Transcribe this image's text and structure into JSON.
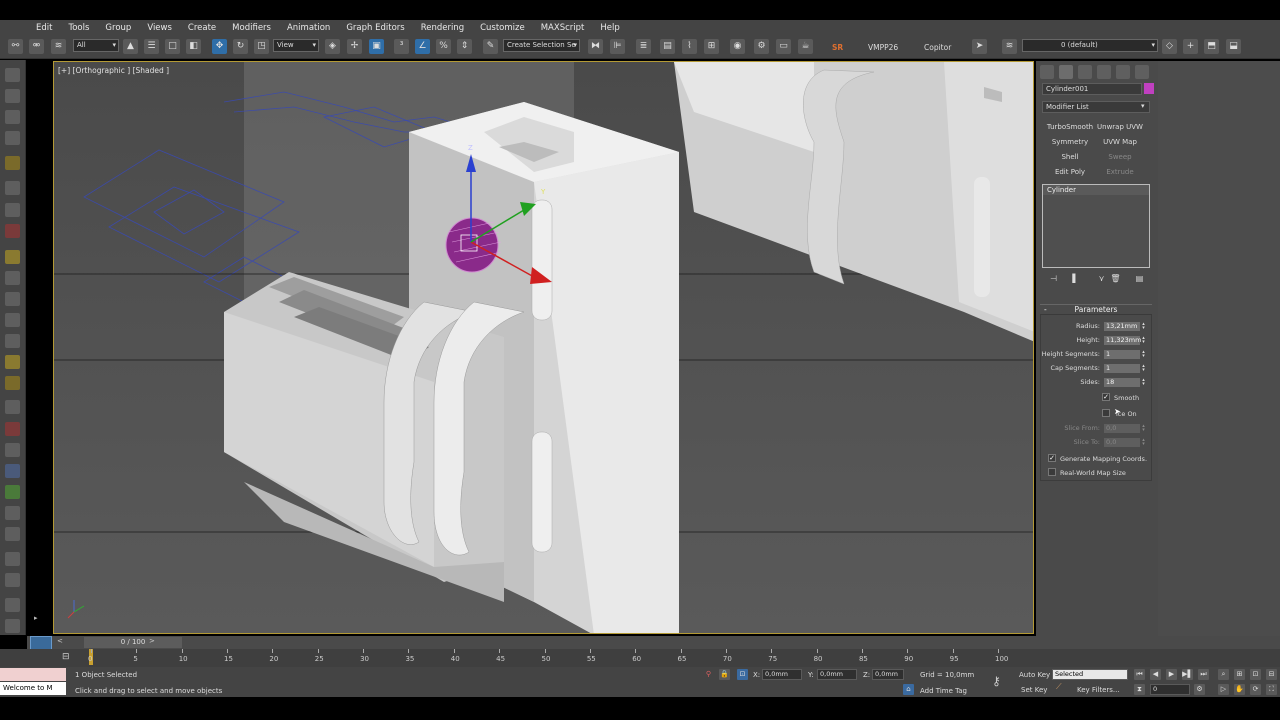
{
  "menu": [
    "Edit",
    "Tools",
    "Group",
    "Views",
    "Create",
    "Modifiers",
    "Animation",
    "Graph Editors",
    "Rendering",
    "Customize",
    "MAXScript",
    "Help"
  ],
  "toolbar": {
    "filter_select": "All",
    "ref_coord": "View",
    "named_selection": "Create Selection Se",
    "plugin_sr": "SR",
    "plugin_vmpp": "VMPP26",
    "plugin_copitor": "Copitor",
    "layer_select": "0 (default)"
  },
  "viewport": {
    "label": "[+] [Orthographic ] [Shaded ]",
    "gizmo_z": "Z",
    "gizmo_y": "Y"
  },
  "command_panel": {
    "object_name": "Cylinder001",
    "object_color": "#c040c0",
    "modifier_list": "Modifier List",
    "modifier_buttons": [
      "TurboSmooth",
      "Unwrap UVW",
      "Symmetry",
      "UVW Map",
      "Shell",
      "Sweep",
      "Edit Poly",
      "Extrude"
    ],
    "stack_items": [
      "Cylinder"
    ],
    "rollout_title": "Parameters",
    "rollout_minus": "-",
    "params": {
      "radius_label": "Radius:",
      "radius": "13,21mm",
      "height_label": "Height:",
      "height": "11,323mm",
      "hseg_label": "Height Segments:",
      "hseg": "1",
      "capseg_label": "Cap Segments:",
      "capseg": "1",
      "sides_label": "Sides:",
      "sides": "18",
      "smooth_label": "Smooth",
      "slice_on_label": "ice On",
      "slice_from_label": "Slice From:",
      "slice_from": "0,0",
      "slice_to_label": "Slice To:",
      "slice_to": "0,0",
      "gen_mapping_label": "Generate Mapping Coords.",
      "realworld_label": "Real-World Map Size"
    }
  },
  "timeline": {
    "frame_counter": "0 / 100",
    "ticks": [
      "0",
      "5",
      "10",
      "15",
      "20",
      "25",
      "30",
      "35",
      "40",
      "45",
      "50",
      "55",
      "60",
      "65",
      "70",
      "75",
      "80",
      "85",
      "90",
      "95",
      "100"
    ]
  },
  "status": {
    "maxscript": "Welcome to M",
    "selection": "1 Object Selected",
    "prompt": "Click and drag to select and move objects",
    "x_label": "X:",
    "x": "0,0mm",
    "y_label": "Y:",
    "y": "0,0mm",
    "z_label": "Z:",
    "z": "0,0mm",
    "grid": "Grid = 10,0mm",
    "add_time_tag": "Add Time Tag",
    "auto_key": "Auto Key",
    "set_key": "Set Key",
    "selected_dropdown": "Selected",
    "key_filters": "Key Filters...",
    "current_frame": "0"
  }
}
